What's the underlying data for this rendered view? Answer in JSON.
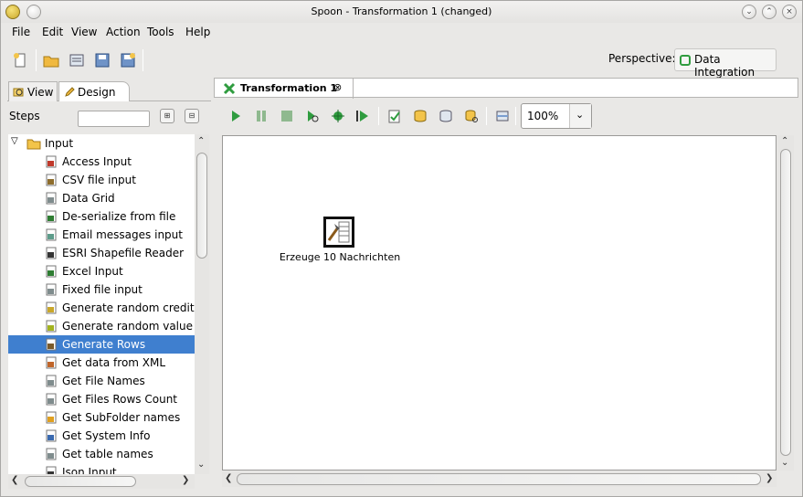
{
  "window": {
    "title": "Spoon - Transformation 1 (changed)"
  },
  "menubar": {
    "items": [
      "File",
      "Edit",
      "View",
      "Action",
      "Tools",
      "Help"
    ]
  },
  "perspective": {
    "label": "Perspective:",
    "button": "Data Integration"
  },
  "left_tabs": {
    "view": "View",
    "design": "Design"
  },
  "steps": {
    "label": "Steps",
    "search_value": ""
  },
  "tree": {
    "category": "Input",
    "items": [
      "Access Input",
      "CSV file input",
      "Data Grid",
      "De-serialize from file",
      "Email messages input",
      "ESRI Shapefile Reader",
      "Excel Input",
      "Fixed file input",
      "Generate random credit ca",
      "Generate random value",
      "Generate Rows",
      "Get data from XML",
      "Get File Names",
      "Get Files Rows Count",
      "Get SubFolder names",
      "Get System Info",
      "Get table names",
      "Json Input"
    ],
    "selected": "Generate Rows"
  },
  "editor_tab": {
    "label": "Transformation 1"
  },
  "zoom": {
    "value": "100%"
  },
  "canvas": {
    "step_label": "Erzeuge 10 Nachrichten"
  },
  "colors": {
    "selection": "#3f7fcf",
    "window_bg": "#e9e8e6"
  }
}
